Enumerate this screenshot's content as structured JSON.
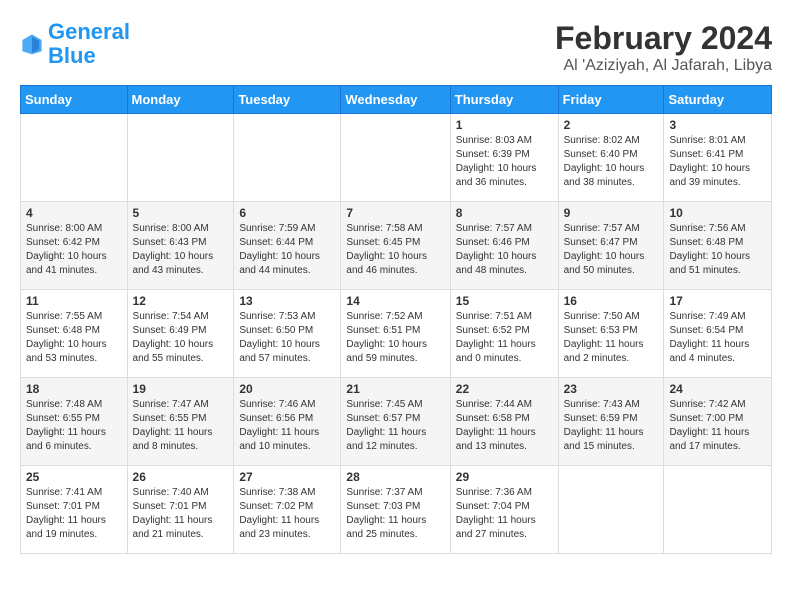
{
  "header": {
    "logo_line1": "General",
    "logo_line2": "Blue",
    "main_title": "February 2024",
    "subtitle": "Al 'Aziziyah, Al Jafarah, Libya"
  },
  "weekdays": [
    "Sunday",
    "Monday",
    "Tuesday",
    "Wednesday",
    "Thursday",
    "Friday",
    "Saturday"
  ],
  "weeks": [
    [
      {
        "day": "",
        "info": ""
      },
      {
        "day": "",
        "info": ""
      },
      {
        "day": "",
        "info": ""
      },
      {
        "day": "",
        "info": ""
      },
      {
        "day": "1",
        "info": "Sunrise: 8:03 AM\nSunset: 6:39 PM\nDaylight: 10 hours\nand 36 minutes."
      },
      {
        "day": "2",
        "info": "Sunrise: 8:02 AM\nSunset: 6:40 PM\nDaylight: 10 hours\nand 38 minutes."
      },
      {
        "day": "3",
        "info": "Sunrise: 8:01 AM\nSunset: 6:41 PM\nDaylight: 10 hours\nand 39 minutes."
      }
    ],
    [
      {
        "day": "4",
        "info": "Sunrise: 8:00 AM\nSunset: 6:42 PM\nDaylight: 10 hours\nand 41 minutes."
      },
      {
        "day": "5",
        "info": "Sunrise: 8:00 AM\nSunset: 6:43 PM\nDaylight: 10 hours\nand 43 minutes."
      },
      {
        "day": "6",
        "info": "Sunrise: 7:59 AM\nSunset: 6:44 PM\nDaylight: 10 hours\nand 44 minutes."
      },
      {
        "day": "7",
        "info": "Sunrise: 7:58 AM\nSunset: 6:45 PM\nDaylight: 10 hours\nand 46 minutes."
      },
      {
        "day": "8",
        "info": "Sunrise: 7:57 AM\nSunset: 6:46 PM\nDaylight: 10 hours\nand 48 minutes."
      },
      {
        "day": "9",
        "info": "Sunrise: 7:57 AM\nSunset: 6:47 PM\nDaylight: 10 hours\nand 50 minutes."
      },
      {
        "day": "10",
        "info": "Sunrise: 7:56 AM\nSunset: 6:48 PM\nDaylight: 10 hours\nand 51 minutes."
      }
    ],
    [
      {
        "day": "11",
        "info": "Sunrise: 7:55 AM\nSunset: 6:48 PM\nDaylight: 10 hours\nand 53 minutes."
      },
      {
        "day": "12",
        "info": "Sunrise: 7:54 AM\nSunset: 6:49 PM\nDaylight: 10 hours\nand 55 minutes."
      },
      {
        "day": "13",
        "info": "Sunrise: 7:53 AM\nSunset: 6:50 PM\nDaylight: 10 hours\nand 57 minutes."
      },
      {
        "day": "14",
        "info": "Sunrise: 7:52 AM\nSunset: 6:51 PM\nDaylight: 10 hours\nand 59 minutes."
      },
      {
        "day": "15",
        "info": "Sunrise: 7:51 AM\nSunset: 6:52 PM\nDaylight: 11 hours\nand 0 minutes."
      },
      {
        "day": "16",
        "info": "Sunrise: 7:50 AM\nSunset: 6:53 PM\nDaylight: 11 hours\nand 2 minutes."
      },
      {
        "day": "17",
        "info": "Sunrise: 7:49 AM\nSunset: 6:54 PM\nDaylight: 11 hours\nand 4 minutes."
      }
    ],
    [
      {
        "day": "18",
        "info": "Sunrise: 7:48 AM\nSunset: 6:55 PM\nDaylight: 11 hours\nand 6 minutes."
      },
      {
        "day": "19",
        "info": "Sunrise: 7:47 AM\nSunset: 6:55 PM\nDaylight: 11 hours\nand 8 minutes."
      },
      {
        "day": "20",
        "info": "Sunrise: 7:46 AM\nSunset: 6:56 PM\nDaylight: 11 hours\nand 10 minutes."
      },
      {
        "day": "21",
        "info": "Sunrise: 7:45 AM\nSunset: 6:57 PM\nDaylight: 11 hours\nand 12 minutes."
      },
      {
        "day": "22",
        "info": "Sunrise: 7:44 AM\nSunset: 6:58 PM\nDaylight: 11 hours\nand 13 minutes."
      },
      {
        "day": "23",
        "info": "Sunrise: 7:43 AM\nSunset: 6:59 PM\nDaylight: 11 hours\nand 15 minutes."
      },
      {
        "day": "24",
        "info": "Sunrise: 7:42 AM\nSunset: 7:00 PM\nDaylight: 11 hours\nand 17 minutes."
      }
    ],
    [
      {
        "day": "25",
        "info": "Sunrise: 7:41 AM\nSunset: 7:01 PM\nDaylight: 11 hours\nand 19 minutes."
      },
      {
        "day": "26",
        "info": "Sunrise: 7:40 AM\nSunset: 7:01 PM\nDaylight: 11 hours\nand 21 minutes."
      },
      {
        "day": "27",
        "info": "Sunrise: 7:38 AM\nSunset: 7:02 PM\nDaylight: 11 hours\nand 23 minutes."
      },
      {
        "day": "28",
        "info": "Sunrise: 7:37 AM\nSunset: 7:03 PM\nDaylight: 11 hours\nand 25 minutes."
      },
      {
        "day": "29",
        "info": "Sunrise: 7:36 AM\nSunset: 7:04 PM\nDaylight: 11 hours\nand 27 minutes."
      },
      {
        "day": "",
        "info": ""
      },
      {
        "day": "",
        "info": ""
      }
    ]
  ]
}
